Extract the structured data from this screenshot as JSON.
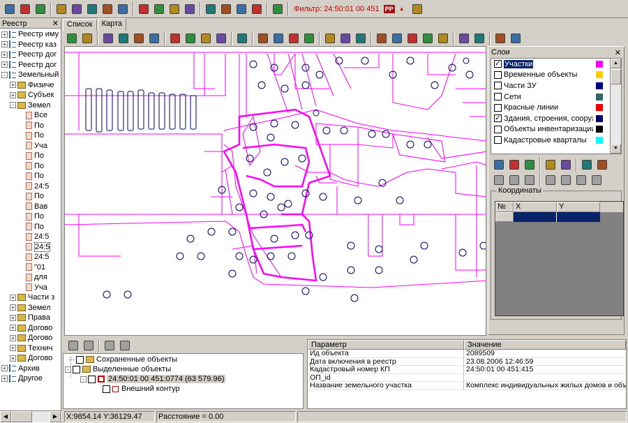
{
  "toolbar": {
    "filter_label": "Фильтр: 24:50:01 00 451",
    "pp_label": "PP",
    "groups": [
      [
        "new-file-icon",
        "book-icon",
        "refresh-report-icon"
      ],
      [
        "document-icon",
        "save-icon",
        "edit-icon",
        "export-icon",
        "delete-icon"
      ],
      [
        "update-icon",
        "link-icon",
        "folder-icon",
        "search-icon"
      ],
      [
        "word-icon",
        "word-export-icon",
        "word-template-icon",
        "stamp-icon"
      ],
      [
        "print-icon"
      ]
    ]
  },
  "left_panel": {
    "title": "Реестр",
    "close": "✕",
    "tree": [
      {
        "indent": 0,
        "pm": "+",
        "icon": "reg",
        "label": "Реестр иму"
      },
      {
        "indent": 0,
        "pm": "+",
        "icon": "reg",
        "label": "Реестр каз"
      },
      {
        "indent": 0,
        "pm": "+",
        "icon": "reg",
        "label": "Реестр дог"
      },
      {
        "indent": 0,
        "pm": "+",
        "icon": "reg",
        "label": "Реестр дог"
      },
      {
        "indent": 0,
        "pm": "-",
        "icon": "reg",
        "label": "Земельный"
      },
      {
        "indent": 1,
        "pm": "+",
        "icon": "fold",
        "label": "Физиче"
      },
      {
        "indent": 1,
        "pm": "+",
        "icon": "fold",
        "label": "Субъек"
      },
      {
        "indent": 1,
        "pm": "-",
        "icon": "fold",
        "label": "Земел"
      },
      {
        "indent": 2,
        "pm": "",
        "icon": "doc",
        "label": "Все"
      },
      {
        "indent": 2,
        "pm": "",
        "icon": "doc",
        "label": "По"
      },
      {
        "indent": 2,
        "pm": "",
        "icon": "doc",
        "label": "По"
      },
      {
        "indent": 2,
        "pm": "",
        "icon": "doc",
        "label": "Уча"
      },
      {
        "indent": 2,
        "pm": "",
        "icon": "doc",
        "label": "По"
      },
      {
        "indent": 2,
        "pm": "",
        "icon": "doc",
        "label": "По"
      },
      {
        "indent": 2,
        "pm": "",
        "icon": "doc",
        "label": "По"
      },
      {
        "indent": 2,
        "pm": "",
        "icon": "doc",
        "label": "24:5"
      },
      {
        "indent": 2,
        "pm": "",
        "icon": "doc",
        "label": "По"
      },
      {
        "indent": 2,
        "pm": "",
        "icon": "doc",
        "label": "Вав"
      },
      {
        "indent": 2,
        "pm": "",
        "icon": "doc",
        "label": "По"
      },
      {
        "indent": 2,
        "pm": "",
        "icon": "doc",
        "label": "По"
      },
      {
        "indent": 2,
        "pm": "",
        "icon": "doc",
        "label": "24:5"
      },
      {
        "indent": 2,
        "pm": "",
        "icon": "doc",
        "label": "24:5",
        "selected": true
      },
      {
        "indent": 2,
        "pm": "",
        "icon": "doc",
        "label": "24:5"
      },
      {
        "indent": 2,
        "pm": "",
        "icon": "doc",
        "label": "\"01"
      },
      {
        "indent": 2,
        "pm": "",
        "icon": "doc",
        "label": "для"
      },
      {
        "indent": 2,
        "pm": "",
        "icon": "doc",
        "label": "Уча"
      },
      {
        "indent": 1,
        "pm": "+",
        "icon": "fold",
        "label": "Части з"
      },
      {
        "indent": 1,
        "pm": "+",
        "icon": "fold",
        "label": "Земел"
      },
      {
        "indent": 1,
        "pm": "+",
        "icon": "fold",
        "label": "Права"
      },
      {
        "indent": 1,
        "pm": "+",
        "icon": "fold",
        "label": "Догово"
      },
      {
        "indent": 1,
        "pm": "+",
        "icon": "fold",
        "label": "Догово"
      },
      {
        "indent": 1,
        "pm": "+",
        "icon": "fold",
        "label": "Технич"
      },
      {
        "indent": 1,
        "pm": "+",
        "icon": "fold",
        "label": "Догово"
      },
      {
        "indent": 0,
        "pm": "+",
        "icon": "reg",
        "label": "Архив"
      },
      {
        "indent": 0,
        "pm": "+",
        "icon": "reg",
        "label": "Другое"
      }
    ]
  },
  "tabs": [
    {
      "label": "Список",
      "active": false
    },
    {
      "label": "Карта",
      "active": true
    }
  ],
  "map_toolbar": [
    "map-list-icon",
    "map-book-icon",
    "pointer-icon",
    "zoom-in-icon",
    "zoom-out-icon",
    "pan-hand-icon",
    "layers-icon",
    "layers-edit-icon",
    "layers-color-icon",
    "eraser-icon",
    "image-icon",
    "add-layer-icon",
    "remove-layer-icon",
    "down-arrow-icon",
    "vertex-icon",
    "grid-icon",
    "table-icon",
    "measure-icon",
    "word-icon",
    "stop-icon",
    "stack-icon",
    "stack-color-icon",
    "star-icon",
    "book-icon",
    "document-icon",
    "globe-icon",
    "comment-icon"
  ],
  "layers_panel": {
    "title": "Слои",
    "close": "✕",
    "items": [
      {
        "label": "Участки",
        "checked": true,
        "color": "#ff00ff",
        "selected": true
      },
      {
        "label": "Временные объекты",
        "checked": false,
        "color": "#ffcc00"
      },
      {
        "label": "Части ЗУ",
        "checked": false,
        "color": "#000080"
      },
      {
        "label": "Сети",
        "checked": false,
        "color": "#336666"
      },
      {
        "label": "Красные линии",
        "checked": false,
        "color": "#ee0000"
      },
      {
        "label": "Здания, строения, сооружен",
        "checked": true,
        "color": "#000066"
      },
      {
        "label": "Объекты инвентаризации",
        "checked": false,
        "color": "#000000"
      },
      {
        "label": "Кадастровые кварталы",
        "checked": false,
        "color": "#00ffff"
      }
    ],
    "coords_title": "Координаты",
    "coords_columns": [
      "№",
      "X",
      "Y"
    ]
  },
  "objects_panel": {
    "saved": "Сохраненные объекты",
    "selected": "Выделенные объекты",
    "object": "24:50:01 00 451:0774 (63 579.96)",
    "contour": "Внешний контур"
  },
  "properties": {
    "columns": [
      "Параметр",
      "Значение"
    ],
    "rows": [
      [
        "Ид объекта",
        "2089509"
      ],
      [
        "Дата включения в реестр",
        "23.08.2006 12:46:59"
      ],
      [
        "Кадастровый номер КП",
        "24:50:01 00 451:415"
      ],
      [
        "ОП_id",
        ""
      ],
      [
        "Название земельного участка",
        "Комплекс индивидуальных жилых домов и объ..."
      ]
    ]
  },
  "status": {
    "coords": "X:9854.14 Y:36129.47",
    "distance": "Расстояние = 0.00"
  }
}
